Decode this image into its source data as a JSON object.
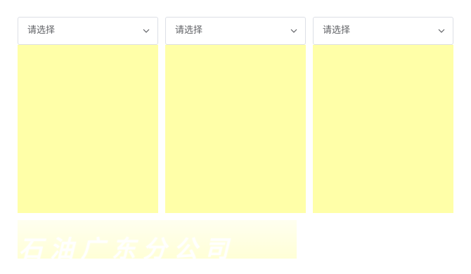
{
  "selects": [
    {
      "placeholder": "请选择",
      "icon": "chevron-down-icon"
    },
    {
      "placeholder": "请选择",
      "icon": "chevron-down-icon"
    },
    {
      "placeholder": "请选择",
      "icon": "chevron-down-icon"
    }
  ],
  "panel_color": "#ffffa8",
  "banner": {
    "text": "石油广东分公司"
  }
}
